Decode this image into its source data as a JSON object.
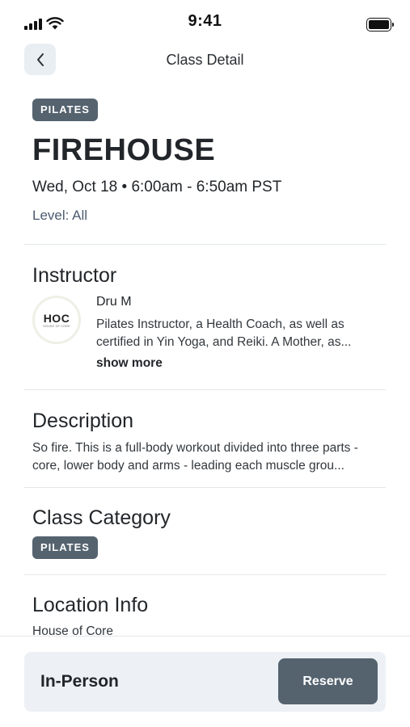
{
  "status_bar": {
    "time": "9:41"
  },
  "nav": {
    "back_icon": "chevron-left-icon",
    "title": "Class Detail"
  },
  "class": {
    "tag": "PILATES",
    "name": "FIREHOUSE",
    "datetime": "Wed, Oct 18 • 6:00am - 6:50am PST",
    "level": "Level: All"
  },
  "instructor": {
    "section_title": "Instructor",
    "avatar_logo": "HOC",
    "avatar_subtext": "HOUSE OF CORE",
    "name": "Dru M",
    "bio": "Pilates Instructor, a Health Coach, as well as certified in Yin Yoga, and Reiki. A Mother, as...",
    "show_more": "show more"
  },
  "description": {
    "section_title": "Description",
    "text": "So fire. This is a full-body workout divided into three parts - core, lower body and arms - leading each muscle grou..."
  },
  "category": {
    "section_title": "Class Category",
    "tag": "PILATES"
  },
  "location": {
    "section_title": "Location Info",
    "name": "House of Core"
  },
  "booking": {
    "type": "In-Person",
    "reserve_label": "Reserve"
  },
  "colors": {
    "tag_bg": "#55636f",
    "card_bg": "#edf1f6",
    "level_text": "#4a5a6e"
  }
}
